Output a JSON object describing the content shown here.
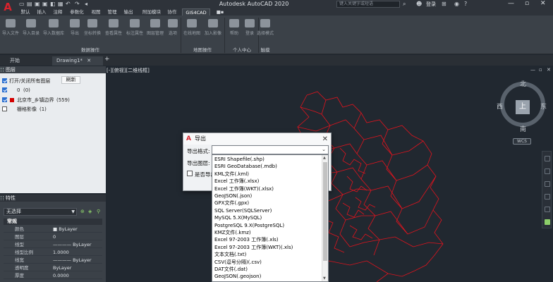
{
  "window": {
    "title": "Autodesk AutoCAD 2020",
    "search_placeholder": "键入关键字或短语",
    "login": "登录"
  },
  "ribbon_tabs": [
    "默认",
    "插入",
    "注释",
    "参数化",
    "视图",
    "管理",
    "输出",
    "附加模块",
    "协作",
    "GIS4CAD",
    "■▪"
  ],
  "ribbon": {
    "data_buttons": [
      "导入文件",
      "导入目录",
      "导入数据库",
      "导出",
      "坐标转换",
      "查看属性",
      "标注属性",
      "图层管理",
      "选项"
    ],
    "data_panel": "数据操作",
    "map_buttons": [
      "在线地图",
      "加入影像"
    ],
    "map_panel": "地图操作",
    "user_buttons": [
      "帮助",
      "登录"
    ],
    "user_panel": "个人中心",
    "touch_buttons": [
      "选择模式"
    ],
    "touch_panel": "触摸"
  },
  "doc_tabs": [
    "开始",
    "Drawing1*"
  ],
  "layers_panel": {
    "title": "图层",
    "toggle_all": "打开/关闭所有图层",
    "refresh": "刷新",
    "items": [
      {
        "name": "0",
        "count": "(0)",
        "checked": true
      },
      {
        "name": "北京市_乡镇边界",
        "count": "(559)",
        "checked": true
      },
      {
        "name": "栅格影像",
        "count": "(1)",
        "checked": false
      }
    ]
  },
  "properties": {
    "title": "特性",
    "selection": "无选择",
    "section": "常规",
    "rows": [
      {
        "key": "颜色",
        "value": "■ ByLayer"
      },
      {
        "key": "图层",
        "value": "0"
      },
      {
        "key": "线型",
        "value": "———— ByLayer"
      },
      {
        "key": "线型比例",
        "value": "1.0000"
      },
      {
        "key": "线宽",
        "value": "———— ByLayer"
      },
      {
        "key": "透明度",
        "value": "ByLayer"
      },
      {
        "key": "厚度",
        "value": "0.0000"
      }
    ]
  },
  "viewport": {
    "label": "[-][俯视][二维线框]",
    "controls": "— ▫ ✕",
    "compass": {
      "north": "北",
      "south": "南",
      "east": "东",
      "west": "西",
      "top": "上"
    },
    "wcs": "WCS"
  },
  "dialog": {
    "title": "导出",
    "format_label": "导出格式:",
    "layer_label": "导出图层:",
    "checkbox_label": "是否导出",
    "format_options": [
      "ESRI Shapefile(.shp)",
      "ESRI GeoDatabase(.mdb)",
      "KML文件(.kml)",
      "Excel 工作簿(.xlsx)",
      "Excel 工作簿(WKT)(.xlsx)",
      "GeoJSON(.json)",
      "GPX文件(.gpx)",
      "SQL Server(SQLServer)",
      "MySQL 5.X(MySQL)",
      "PostgreSQL 9.X(PostgreSQL)",
      "KMZ文件(.kmz)",
      "Excel 97-2003 工作簿(.xls)",
      "Excel 97-2003 工作簿(WKT)(.xls)",
      "文本文档(.txt)",
      "CSV(逗号分隔)(.csv)",
      "DAT文件(.dat)",
      "GeoJSON(.geojson)"
    ]
  },
  "colors": {
    "accent": "#d7232d",
    "map_line": "#e0141e",
    "background": "#212830"
  }
}
